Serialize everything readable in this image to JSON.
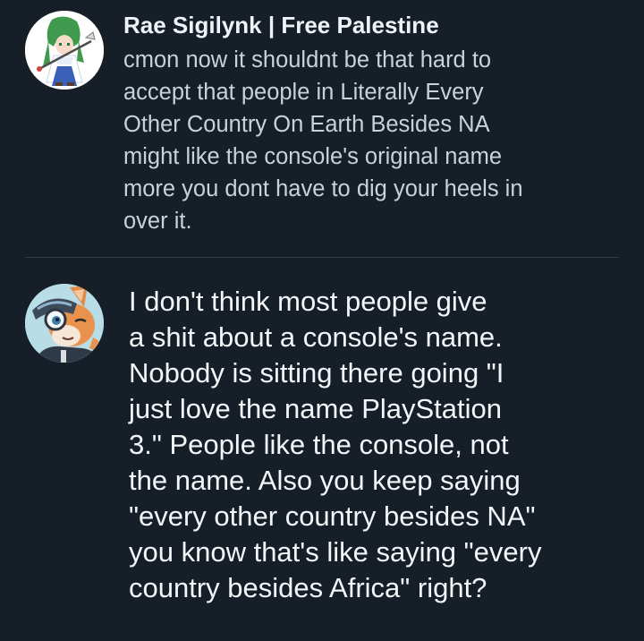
{
  "reply": {
    "author": "Rae Sigilynk | Free Palestine",
    "lines": [
      "cmon now it shouldnt be that hard to",
      "accept that people in Literally Every",
      "Other Country On Earth Besides NA",
      "might like the console's original name",
      "more you dont have to dig your heels in",
      "over it."
    ]
  },
  "post": {
    "lines": [
      "I don't think most people give",
      "a shit about a console's name.",
      "Nobody is sitting there going \"I",
      "just love the name PlayStation",
      "3.\" People like the console, not",
      "the name. Also you keep saying",
      "\"every other country besides NA\"",
      "you know that's like saying \"every",
      "country besides Africa\" right?"
    ]
  },
  "colors": {
    "background": "#161e27",
    "name_text": "#eef3f7",
    "reply_text": "#c9d2dc",
    "post_text": "#f3f6f9",
    "divider": "#313c49"
  },
  "icons": {
    "reply_avatar": "avatar-green-haired-character-icon",
    "post_avatar": "avatar-fox-character-icon"
  }
}
